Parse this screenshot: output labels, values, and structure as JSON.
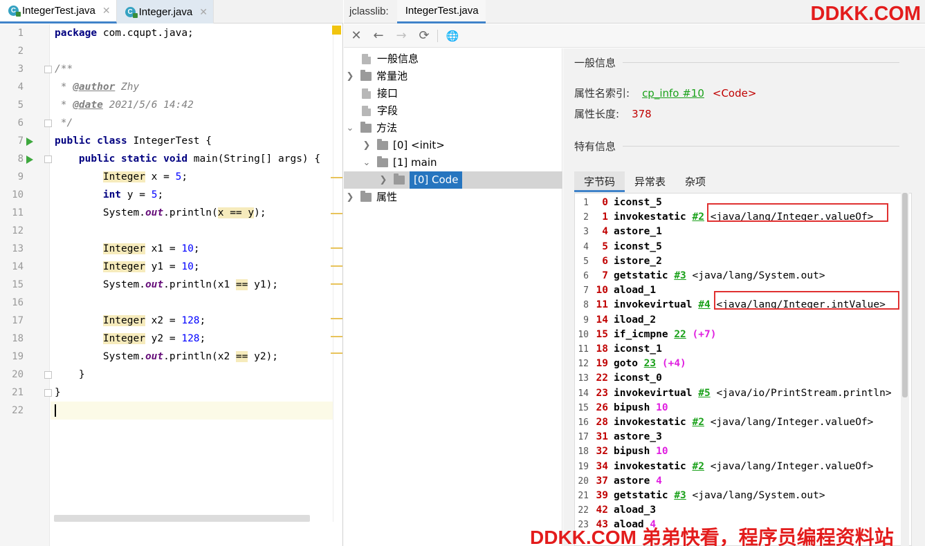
{
  "editor": {
    "tabs": [
      {
        "label": "IntegerTest.java",
        "close": "✕"
      },
      {
        "label": "Integer.java",
        "close": "✕"
      }
    ],
    "line_numbers": [
      "1",
      "2",
      "3",
      "4",
      "5",
      "6",
      "7",
      "8",
      "9",
      "10",
      "11",
      "12",
      "13",
      "14",
      "15",
      "16",
      "17",
      "18",
      "19",
      "20",
      "21",
      "22"
    ],
    "code": {
      "l1_kw": "package",
      "l1_rest": " com.cqupt.java;",
      "l3": "/**",
      "l4_pre": " * ",
      "l4_tag": "@author",
      "l4_val": " Zhy",
      "l5_pre": " * ",
      "l5_tag": "@date",
      "l5_val": " 2021/5/6 14:42",
      "l6": " */",
      "l7_kw": "public class",
      "l7_rest": " IntegerTest {",
      "l8_kw": "public static void",
      "l8_rest": " main(String[] args) {",
      "l9_type": "Integer",
      "l9_mid": " x = ",
      "l9_num": "5",
      "l9_end": ";",
      "l10_kw": "int",
      "l10_mid": " y = ",
      "l10_num": "5",
      "l10_end": ";",
      "l11_a": "System.",
      "l11_fld": "out",
      "l11_b": ".println(",
      "l11_hl": "x == y",
      "l11_c": ");",
      "l13_type": "Integer",
      "l13_mid": " x1 = ",
      "l13_num": "10",
      "l13_end": ";",
      "l14_type": "Integer",
      "l14_mid": " y1 = ",
      "l14_num": "10",
      "l14_end": ";",
      "l15_a": "System.",
      "l15_fld": "out",
      "l15_b": ".println(x1 ",
      "l15_hl": "==",
      "l15_c": " y1);",
      "l17_type": "Integer",
      "l17_mid": " x2 = ",
      "l17_num": "128",
      "l17_end": ";",
      "l18_type": "Integer",
      "l18_mid": " y2 = ",
      "l18_num": "128",
      "l18_end": ";",
      "l19_a": "System.",
      "l19_fld": "out",
      "l19_b": ".println(x2 ",
      "l19_hl": "==",
      "l19_c": " y2);",
      "l20": "}",
      "l21": "}"
    }
  },
  "jclasslib": {
    "title": "jclasslib:",
    "tab": "IntegerTest.java",
    "watermark_top": "DDKK.COM",
    "toolbar": {
      "close": "✕",
      "back": "←",
      "forward": "→",
      "refresh": "⟳",
      "web": "🌐"
    },
    "tree": {
      "general": "一般信息",
      "constant_pool": "常量池",
      "interfaces": "接口",
      "fields": "字段",
      "methods": "方法",
      "init": "[0] <init>",
      "main": "[1] main",
      "code": "[0] Code",
      "attributes": "属性"
    },
    "detail": {
      "general_header": "一般信息",
      "attr_name_label": "属性名索引:",
      "attr_name_link": "cp_info #10",
      "attr_name_tag": "<Code>",
      "attr_len_label": "属性长度:",
      "attr_len_val": "378",
      "specific_header": "特有信息",
      "tabs": [
        "字节码",
        "异常表",
        "杂项"
      ]
    },
    "bytecode": [
      {
        "i": "1",
        "off": "0",
        "ins": "iconst_5"
      },
      {
        "i": "2",
        "off": "1",
        "ins": "invokestatic",
        "ref": "#2",
        "cls": "<java/lang/Integer.valueOf>"
      },
      {
        "i": "3",
        "off": "4",
        "ins": "astore_1"
      },
      {
        "i": "4",
        "off": "5",
        "ins": "iconst_5"
      },
      {
        "i": "5",
        "off": "6",
        "ins": "istore_2"
      },
      {
        "i": "6",
        "off": "7",
        "ins": "getstatic",
        "ref": "#3",
        "cls": "<java/lang/System.out>"
      },
      {
        "i": "7",
        "off": "10",
        "ins": "aload_1"
      },
      {
        "i": "8",
        "off": "11",
        "ins": "invokevirtual",
        "ref": "#4",
        "cls": "<java/lang/Integer.intValue>"
      },
      {
        "i": "9",
        "off": "14",
        "ins": "iload_2"
      },
      {
        "i": "10",
        "off": "15",
        "ins": "if_icmpne",
        "ref": "22",
        "pink": "(+7)"
      },
      {
        "i": "11",
        "off": "18",
        "ins": "iconst_1"
      },
      {
        "i": "12",
        "off": "19",
        "ins": "goto",
        "ref": "23",
        "pink": "(+4)"
      },
      {
        "i": "13",
        "off": "22",
        "ins": "iconst_0"
      },
      {
        "i": "14",
        "off": "23",
        "ins": "invokevirtual",
        "ref": "#5",
        "cls": "<java/io/PrintStream.println>"
      },
      {
        "i": "15",
        "off": "26",
        "ins": "bipush",
        "pink": "10"
      },
      {
        "i": "16",
        "off": "28",
        "ins": "invokestatic",
        "ref": "#2",
        "cls": "<java/lang/Integer.valueOf>"
      },
      {
        "i": "17",
        "off": "31",
        "ins": "astore_3"
      },
      {
        "i": "18",
        "off": "32",
        "ins": "bipush",
        "pink": "10"
      },
      {
        "i": "19",
        "off": "34",
        "ins": "invokestatic",
        "ref": "#2",
        "cls": "<java/lang/Integer.valueOf>"
      },
      {
        "i": "20",
        "off": "37",
        "ins": "astore",
        "pink": "4"
      },
      {
        "i": "21",
        "off": "39",
        "ins": "getstatic",
        "ref": "#3",
        "cls": "<java/lang/System.out>"
      },
      {
        "i": "22",
        "off": "42",
        "ins": "aload_3"
      },
      {
        "i": "23",
        "off": "43",
        "ins": "aload",
        "pink": "4"
      }
    ],
    "bytecode_scroll": {
      "position": 0.0,
      "visible_fraction": 0.58
    }
  },
  "watermark_bottom": "DDKK.COM 弟弟快看，程序员编程资料站",
  "colors": {
    "accent": "#4083c9",
    "selection": "#2675bf",
    "offset_red": "#c00000",
    "ref_green": "#1aa11a",
    "watermark_red": "#e31c1c",
    "highlight_box": "#e03030"
  }
}
